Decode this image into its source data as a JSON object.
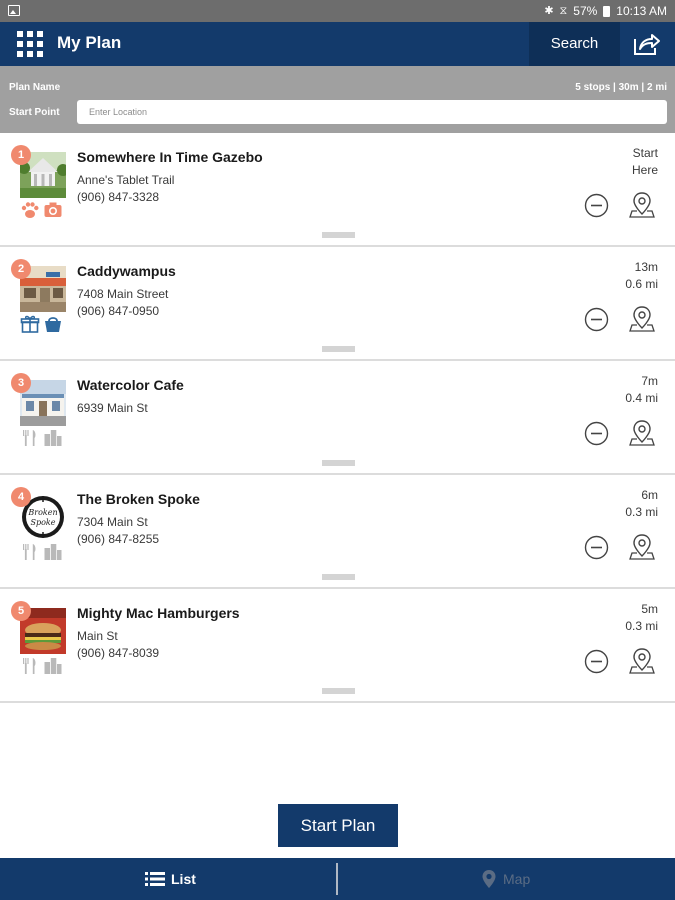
{
  "status_bar": {
    "battery": "57%",
    "time": "10:13 AM"
  },
  "app_bar": {
    "title": "My Plan",
    "search_label": "Search"
  },
  "plan_header": {
    "plan_name_label": "Plan Name",
    "summary": "5 stops | 30m | 2 mi",
    "start_point_label": "Start Point",
    "start_point_placeholder": "Enter Location",
    "start_point_value": ""
  },
  "stops": [
    {
      "number": "1",
      "name": "Somewhere In Time Gazebo",
      "line1": "Anne's Tablet Trail",
      "line2": "(906) 847-3328",
      "time": "Start",
      "distance": "Here",
      "categories": [
        "paw-icon",
        "camera-icon"
      ]
    },
    {
      "number": "2",
      "name": "Caddywampus",
      "line1": "7408 Main Street",
      "line2": "(906) 847-0950",
      "time": "13m",
      "distance": "0.6 mi",
      "categories": [
        "gift-icon",
        "shopping-basket-icon"
      ]
    },
    {
      "number": "3",
      "name": "Watercolor Cafe",
      "line1": "6939 Main St",
      "line2": "",
      "time": "7m",
      "distance": "0.4 mi",
      "categories": [
        "fork-knife-icon",
        "buildings-icon"
      ]
    },
    {
      "number": "4",
      "name": "The Broken Spoke",
      "line1": "7304 Main St",
      "line2": "(906) 847-8255",
      "time": "6m",
      "distance": "0.3 mi",
      "categories": [
        "fork-knife-icon",
        "buildings-icon"
      ]
    },
    {
      "number": "5",
      "name": "Mighty Mac Hamburgers",
      "line1": "Main St",
      "line2": "(906) 847-8039",
      "time": "5m",
      "distance": "0.3 mi",
      "categories": [
        "fork-knife-icon",
        "buildings-icon"
      ]
    }
  ],
  "start_button_label": "Start Plan",
  "bottom_nav": {
    "list_label": "List",
    "map_label": "Map",
    "active_tab": "List"
  },
  "colors": {
    "primary": "#133a6b",
    "badge": "#f0896e",
    "header_gray": "#a0a0a0",
    "icon_orange": "#f0896e",
    "icon_blue": "#2f6aa0",
    "icon_gray": "#b9b9b9"
  }
}
